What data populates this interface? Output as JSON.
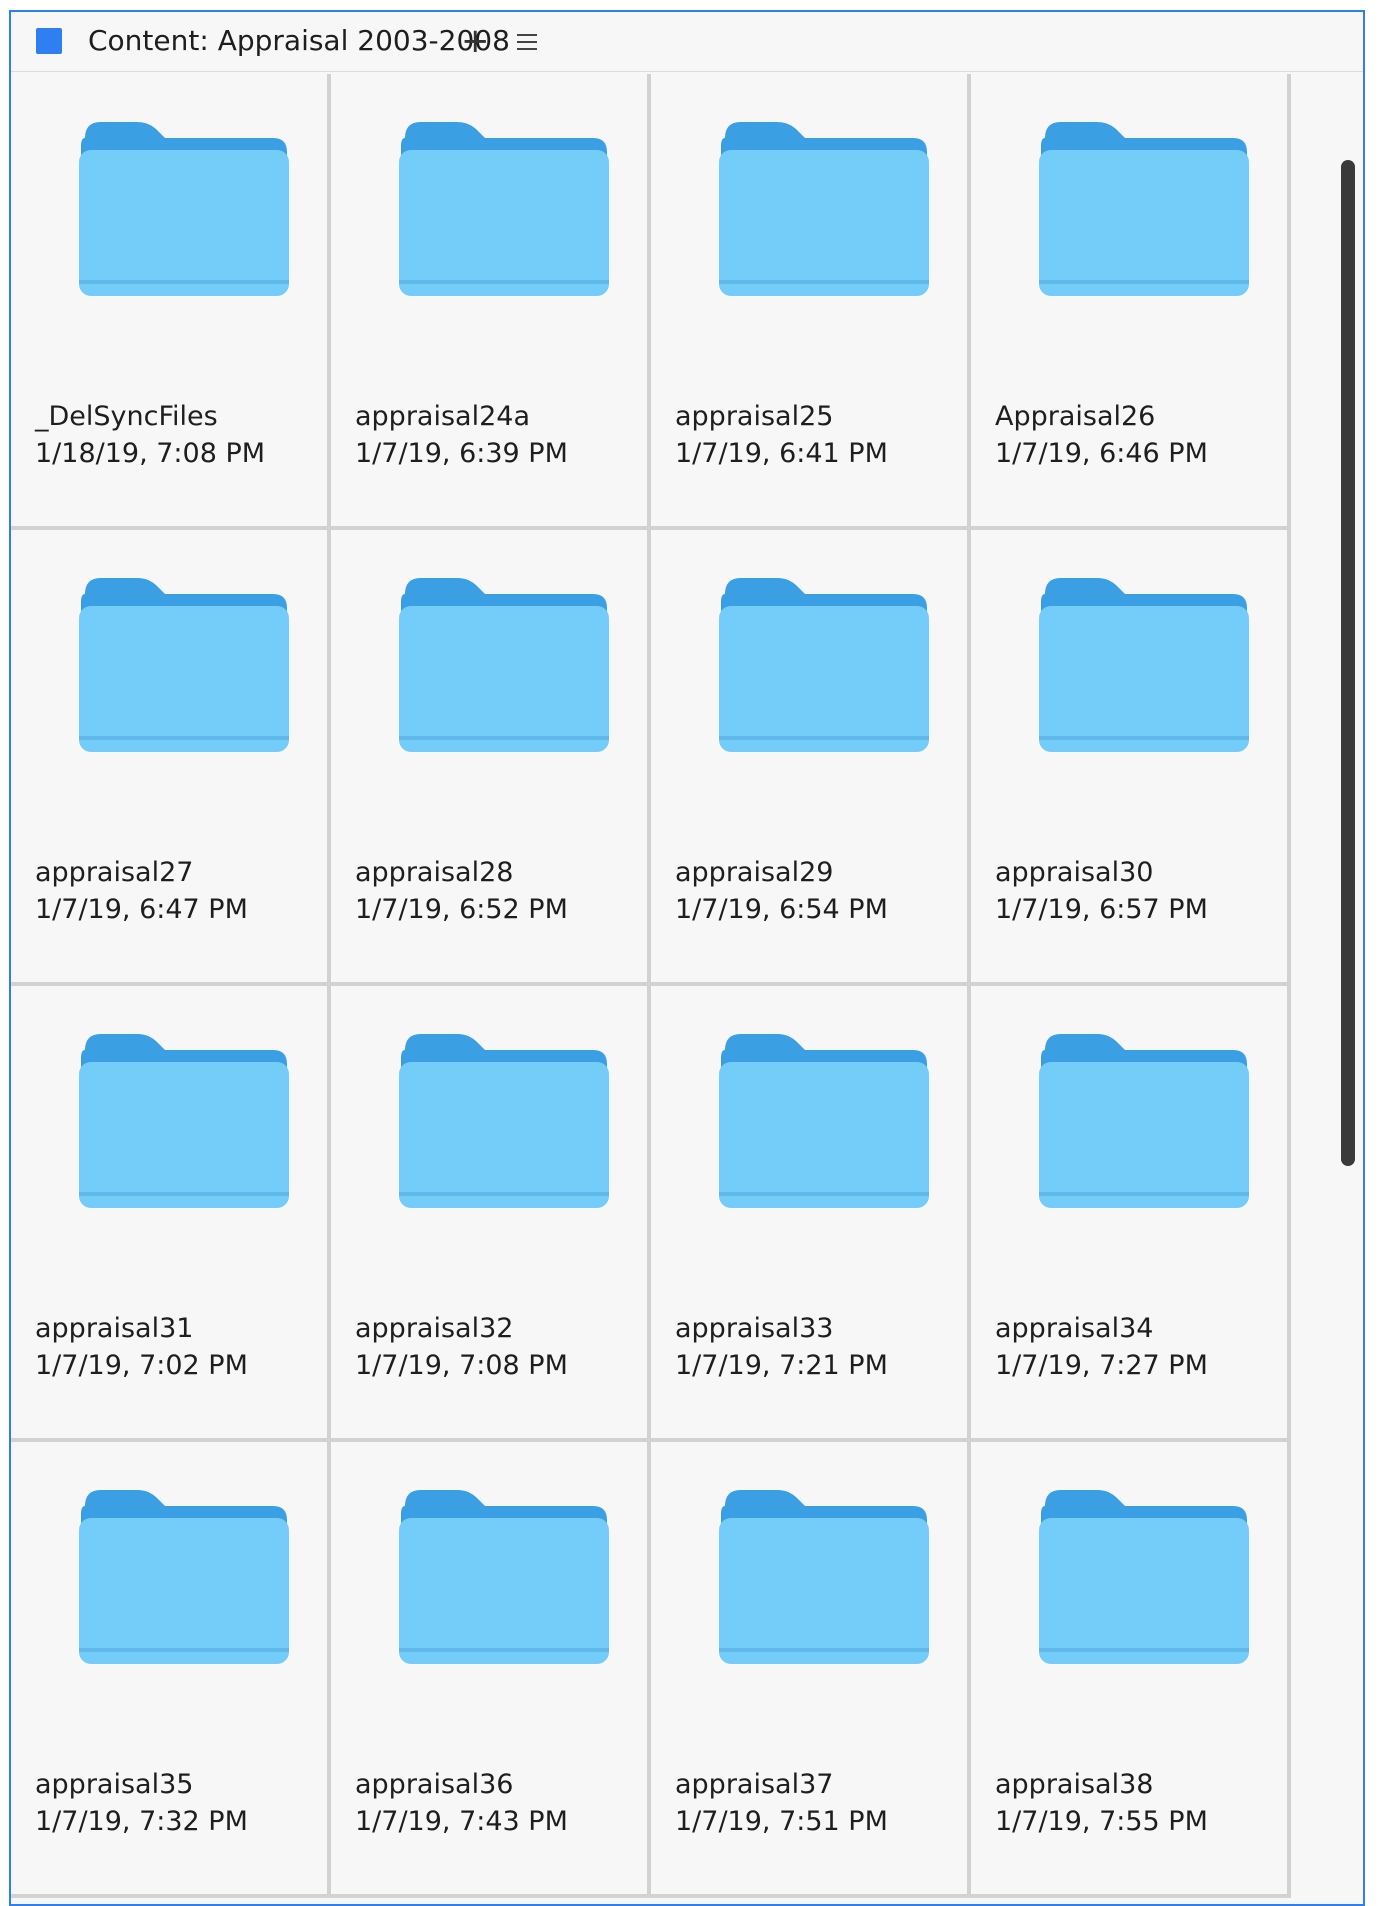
{
  "panel": {
    "title": "Content: Appraisal 2003-2008",
    "swatch_color": "#2f7ef2",
    "add_icon": "plus-icon",
    "menu_icon": "hamburger-menu-icon"
  },
  "colors": {
    "folder_back": "#3a9fe3",
    "folder_front": "#74cdf9",
    "panel_border": "#2f7ef2"
  },
  "items": [
    {
      "name": "_DelSyncFiles",
      "date": "1/18/19, 7:08 PM"
    },
    {
      "name": "appraisal24a",
      "date": "1/7/19, 6:39 PM"
    },
    {
      "name": "appraisal25",
      "date": "1/7/19, 6:41 PM"
    },
    {
      "name": "Appraisal26",
      "date": "1/7/19, 6:46 PM"
    },
    {
      "name": "appraisal27",
      "date": "1/7/19, 6:47 PM"
    },
    {
      "name": "appraisal28",
      "date": "1/7/19, 6:52 PM"
    },
    {
      "name": "appraisal29",
      "date": "1/7/19, 6:54 PM"
    },
    {
      "name": "appraisal30",
      "date": "1/7/19, 6:57 PM"
    },
    {
      "name": "appraisal31",
      "date": "1/7/19, 7:02 PM"
    },
    {
      "name": "appraisal32",
      "date": "1/7/19, 7:08 PM"
    },
    {
      "name": "appraisal33",
      "date": "1/7/19, 7:21 PM"
    },
    {
      "name": "appraisal34",
      "date": "1/7/19, 7:27 PM"
    },
    {
      "name": "appraisal35",
      "date": "1/7/19, 7:32 PM"
    },
    {
      "name": "appraisal36",
      "date": "1/7/19, 7:43 PM"
    },
    {
      "name": "appraisal37",
      "date": "1/7/19, 7:51 PM"
    },
    {
      "name": "appraisal38",
      "date": "1/7/19, 7:55 PM"
    }
  ]
}
